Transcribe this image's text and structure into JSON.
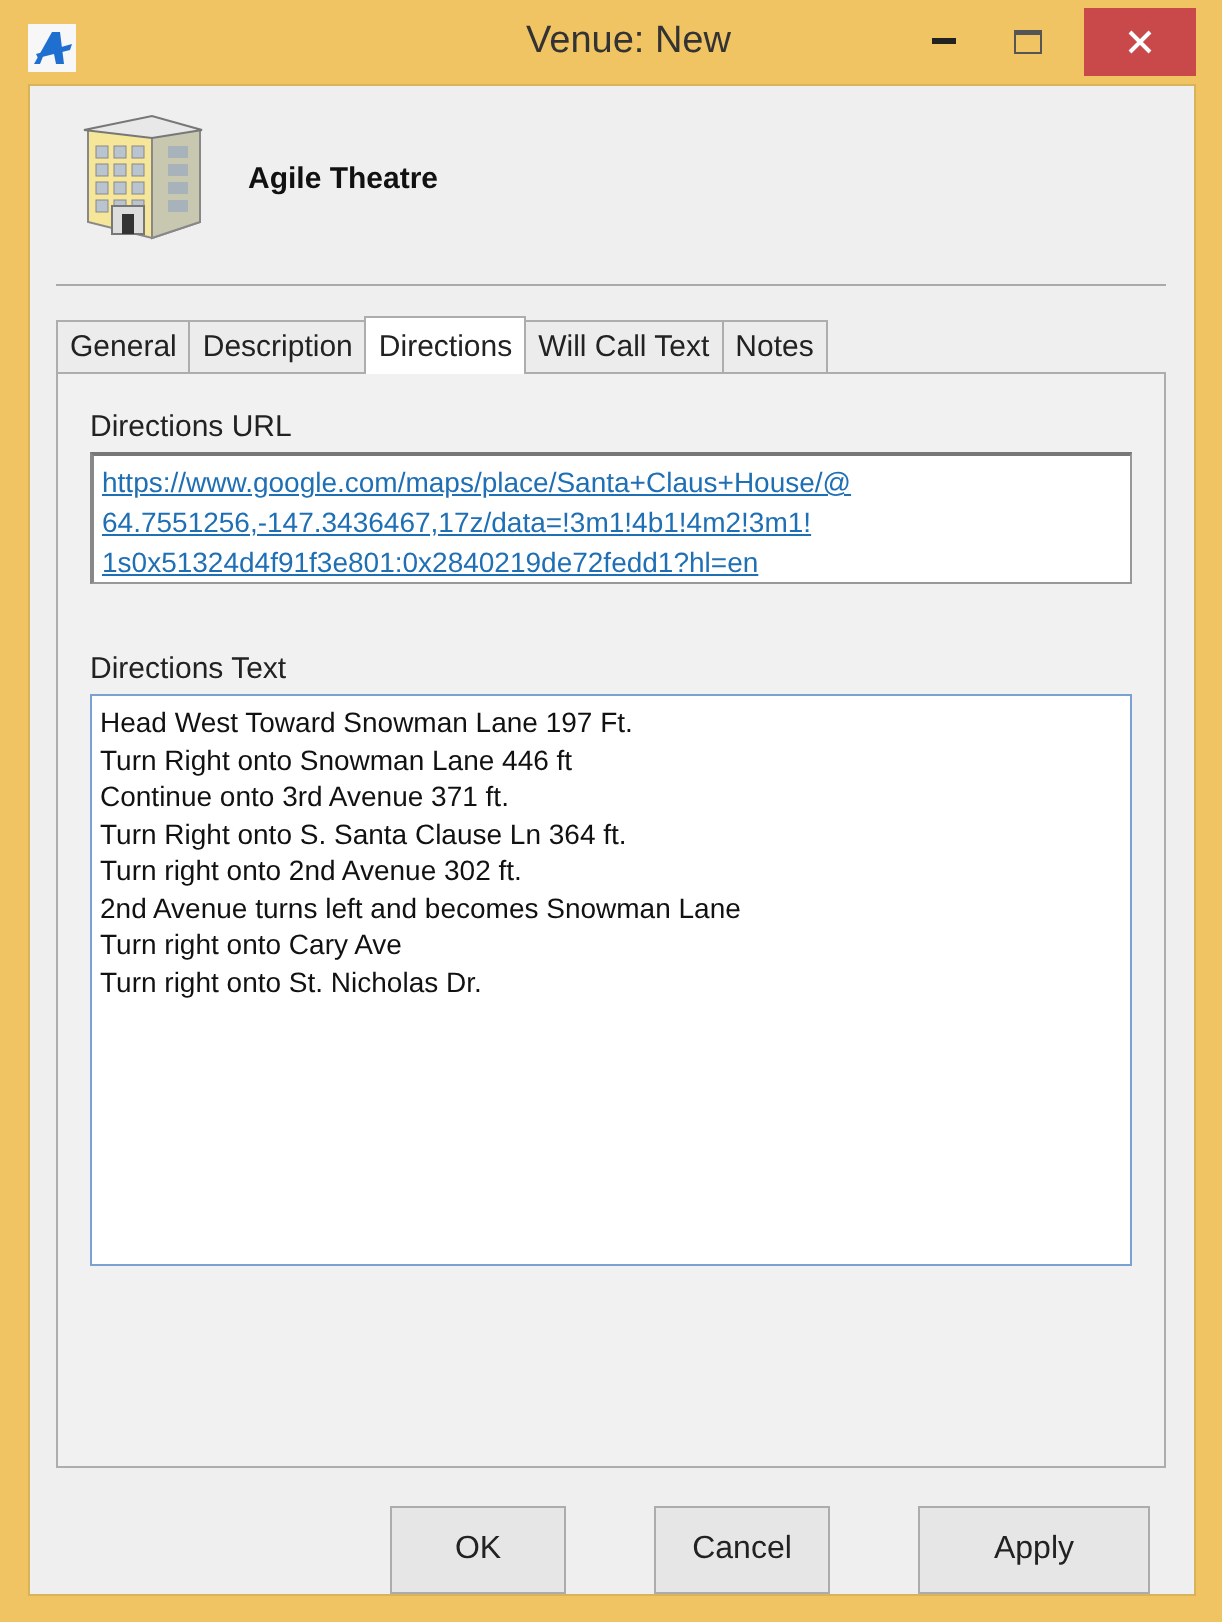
{
  "window": {
    "title": "Venue: New"
  },
  "header": {
    "name": "Agile Theatre"
  },
  "tabs": [
    {
      "label": "General",
      "selected": false
    },
    {
      "label": "Description",
      "selected": false
    },
    {
      "label": "Directions",
      "selected": true
    },
    {
      "label": "Will Call Text",
      "selected": false
    },
    {
      "label": "Notes",
      "selected": false
    }
  ],
  "directions_url": {
    "label": "Directions URL",
    "lines": [
      "https://www.google.com/maps/place/Santa+Claus+House/@",
      "64.7551256,-147.3436467,17z/data=!3m1!4b1!4m2!3m1!",
      "1s0x51324d4f91f3e801:0x2840219de72fedd1?hl=en"
    ]
  },
  "directions_text": {
    "label": "Directions Text",
    "lines": [
      "Head West Toward Snowman Lane 197 Ft.",
      "Turn Right onto Snowman Lane 446 ft",
      "Continue onto 3rd Avenue 371 ft.",
      "Turn Right onto S. Santa Clause Ln 364 ft.",
      "Turn right onto 2nd Avenue 302 ft.",
      "2nd Avenue turns left and becomes Snowman Lane",
      "Turn right onto Cary Ave",
      "Turn right onto St. Nicholas Dr."
    ]
  },
  "buttons": [
    "OK",
    "Cancel",
    "Apply"
  ]
}
